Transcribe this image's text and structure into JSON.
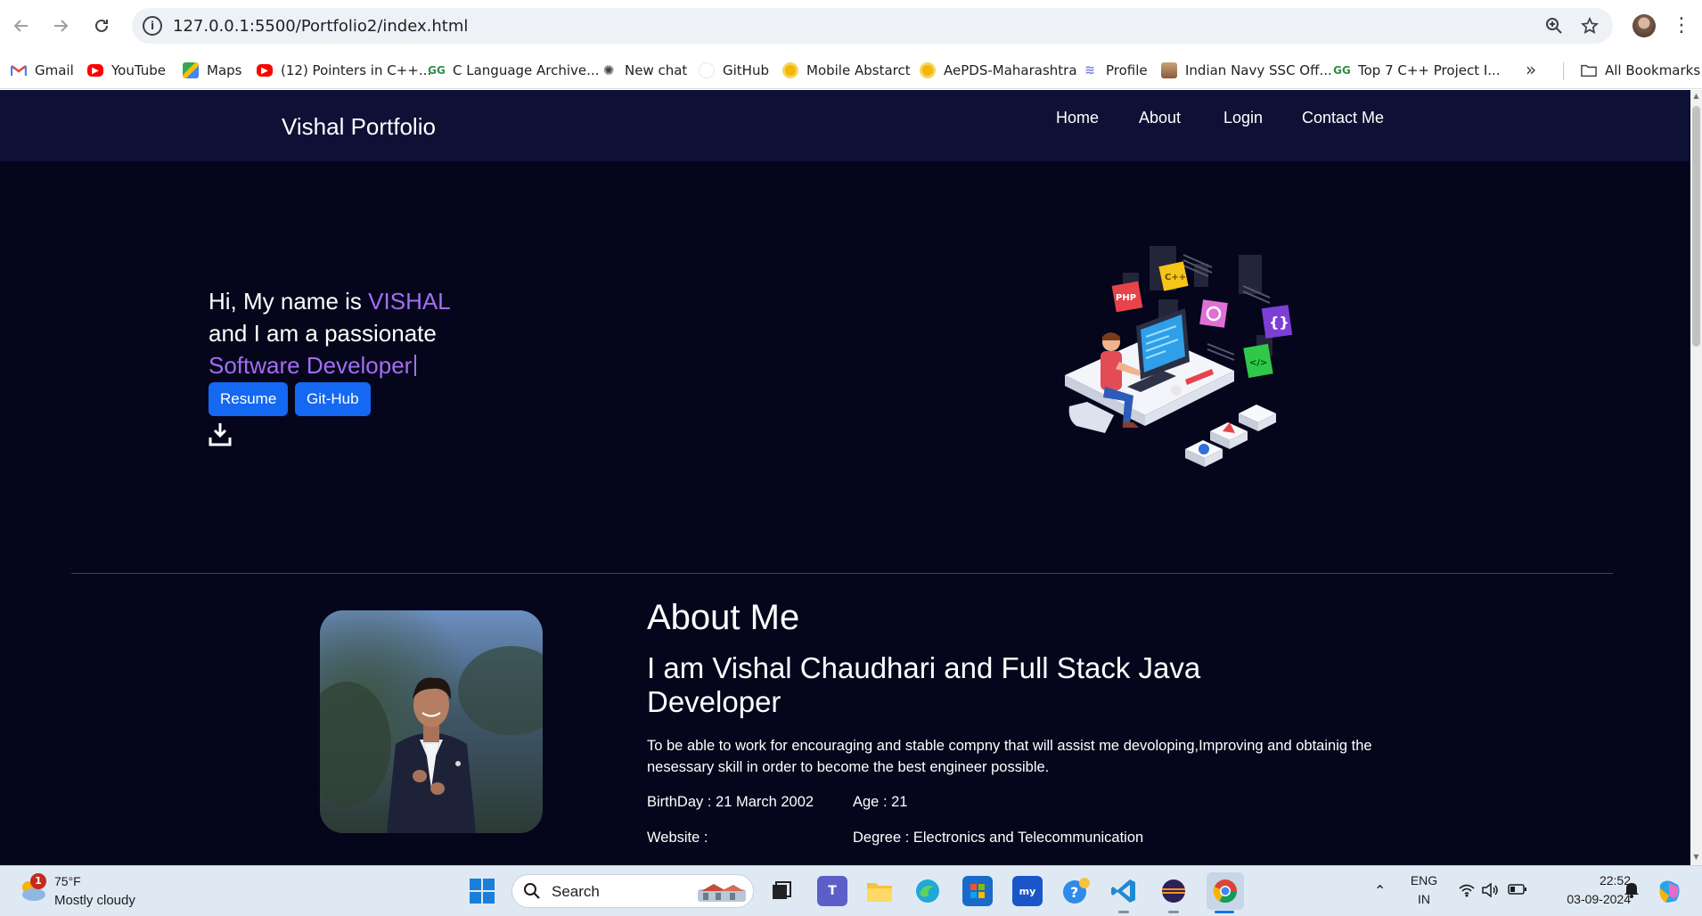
{
  "browser": {
    "url": "127.0.0.1:5500/Portfolio2/index.html",
    "back_icon": "arrow-left-icon",
    "forward_icon": "arrow-right-icon",
    "reload_icon": "reload-icon",
    "site_info_icon": "info-icon",
    "zoom_icon": "zoom-icon",
    "star_icon": "star-icon",
    "menu_icon": "kebab-menu-icon"
  },
  "bookmarks": {
    "items": [
      {
        "label": "Gmail",
        "icon": "gmail-icon",
        "color": "#ea4335"
      },
      {
        "label": "YouTube",
        "icon": "youtube-icon",
        "color": "#ff0000"
      },
      {
        "label": "Maps",
        "icon": "maps-icon",
        "color": "#34a853"
      },
      {
        "label": "(12) Pointers in C++...",
        "icon": "youtube-icon",
        "color": "#ff0000"
      },
      {
        "label": "C Language Archive...",
        "icon": "geeksforgeeks-icon",
        "color": "#2f8d46"
      },
      {
        "label": "New chat",
        "icon": "chatgpt-icon",
        "color": "#444444"
      },
      {
        "label": "GitHub",
        "icon": "github-icon",
        "color": "#ffffff"
      },
      {
        "label": "Mobile Abstarct",
        "icon": "circle-icon",
        "color": "#f2b705"
      },
      {
        "label": "AePDS-Maharashtra",
        "icon": "circle-icon",
        "color": "#f2b705"
      },
      {
        "label": "Profile",
        "icon": "profile-icon",
        "color": "#7b86d9"
      },
      {
        "label": "Indian Navy SSC Off...",
        "icon": "navy-icon",
        "color": "#8a5a3a"
      },
      {
        "label": "Top 7 C++ Project I...",
        "icon": "geeksforgeeks-icon",
        "color": "#2f8d46"
      }
    ],
    "overflow_icon": "chevron-double-right-icon",
    "all_bookmarks": "All Bookmarks"
  },
  "site": {
    "brand": "Vishal Portfolio",
    "nav": [
      "Home",
      "About",
      "Login",
      "Contact Me"
    ]
  },
  "hero": {
    "line1_prefix": "Hi, My name is ",
    "name": "VISHAL",
    "line2": "and I am a passionate",
    "role": "Software Developer",
    "buttons": [
      "Resume",
      "Git-Hub"
    ],
    "download_icon": "download-icon"
  },
  "about": {
    "title": "About Me",
    "subtitle": "I am Vishal Chaudhari and Full Stack Java Developer",
    "paragraph": "To be able to work for encouraging and stable compny that will assist me devoloping,Improving and obtainig the nesessary skill in order to become the best engineer possible.",
    "birthday": "BirthDay : 21 March 2002",
    "age": "Age : 21",
    "website": "Website :",
    "degree": "Degree : Electronics and Telecommunication"
  },
  "taskbar": {
    "weather_temp": "75°F",
    "weather_desc": "Mostly cloudy",
    "notification_count": "1",
    "search": "Search",
    "lang1": "ENG",
    "lang2": "IN",
    "time": "22:52",
    "date": "03-09-2024"
  },
  "colors": {
    "page_bg": "#05061c",
    "navbar_bg": "#0e1035",
    "accent": "#a36ef0",
    "button": "#1468f2"
  }
}
